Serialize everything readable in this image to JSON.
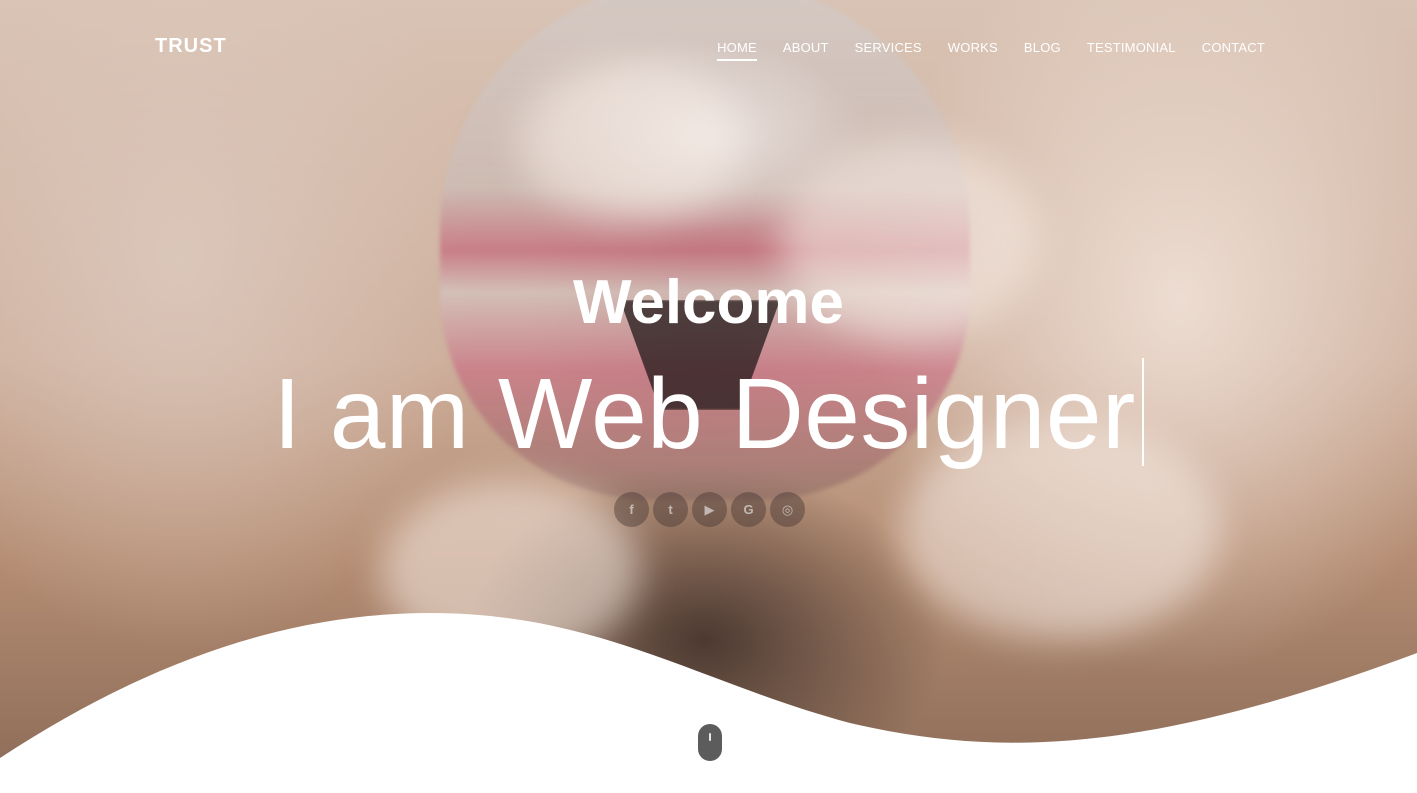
{
  "brand": {
    "logo": "TRUST"
  },
  "nav": {
    "items": [
      {
        "label": "HOME",
        "active": true
      },
      {
        "label": "ABOUT"
      },
      {
        "label": "SERVICES"
      },
      {
        "label": "WORKS"
      },
      {
        "label": "BLOG"
      },
      {
        "label": "TESTIMONIAL"
      },
      {
        "label": "CONTACT"
      }
    ]
  },
  "hero": {
    "welcome": "Welcome",
    "typed_text": "I am Web Designer"
  },
  "socials": [
    {
      "icon": "facebook-icon",
      "glyph": "f"
    },
    {
      "icon": "twitter-icon",
      "glyph": "t"
    },
    {
      "icon": "youtube-icon",
      "glyph": "▶"
    },
    {
      "icon": "google-icon",
      "glyph": "G"
    },
    {
      "icon": "instagram-icon",
      "glyph": "◎"
    }
  ],
  "colors": {
    "text": "#ffffff",
    "wave": "#ffffff",
    "mouse": "#5c5c5c"
  }
}
